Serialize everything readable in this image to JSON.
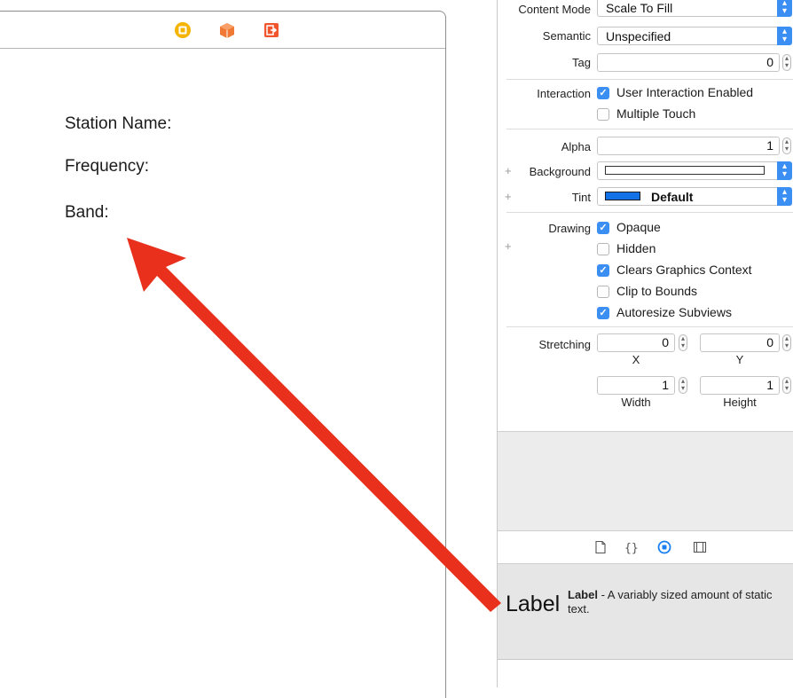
{
  "scene": {
    "labels": [
      "Station Name:",
      "Frequency:",
      "Band:"
    ],
    "dock_icons": [
      "view-controller-icon",
      "first-responder-icon",
      "exit-icon"
    ]
  },
  "inspector": {
    "content_mode": {
      "label": "Content Mode",
      "value": "Scale To Fill"
    },
    "semantic": {
      "label": "Semantic",
      "value": "Unspecified"
    },
    "tag": {
      "label": "Tag",
      "value": "0"
    },
    "interaction": {
      "label": "Interaction",
      "options": [
        {
          "label": "User Interaction Enabled",
          "checked": true
        },
        {
          "label": "Multiple Touch",
          "checked": false
        }
      ]
    },
    "alpha": {
      "label": "Alpha",
      "value": "1"
    },
    "background": {
      "label": "Background",
      "color": "#ffffff"
    },
    "tint": {
      "label": "Tint",
      "value": "Default",
      "color": "#1472e8"
    },
    "drawing": {
      "label": "Drawing",
      "options": [
        {
          "label": "Opaque",
          "checked": true
        },
        {
          "label": "Hidden",
          "checked": false
        },
        {
          "label": "Clears Graphics Context",
          "checked": true
        },
        {
          "label": "Clip to Bounds",
          "checked": false
        },
        {
          "label": "Autoresize Subviews",
          "checked": true
        }
      ]
    },
    "stretching": {
      "label": "Stretching",
      "x": "0",
      "y": "0",
      "width": "1",
      "height": "1",
      "captions": {
        "x": "X",
        "y": "Y",
        "width": "Width",
        "height": "Height"
      }
    }
  },
  "library": {
    "tabs": [
      "file-icon",
      "braces-icon",
      "object-library-icon",
      "media-icon"
    ],
    "active_tab": "object-library-icon",
    "item": {
      "preview": "Label",
      "name": "Label",
      "description": " - A variably sized amount of static text."
    }
  },
  "colors": {
    "accent": "#3b8ff3",
    "arrow": "#e8301c"
  }
}
